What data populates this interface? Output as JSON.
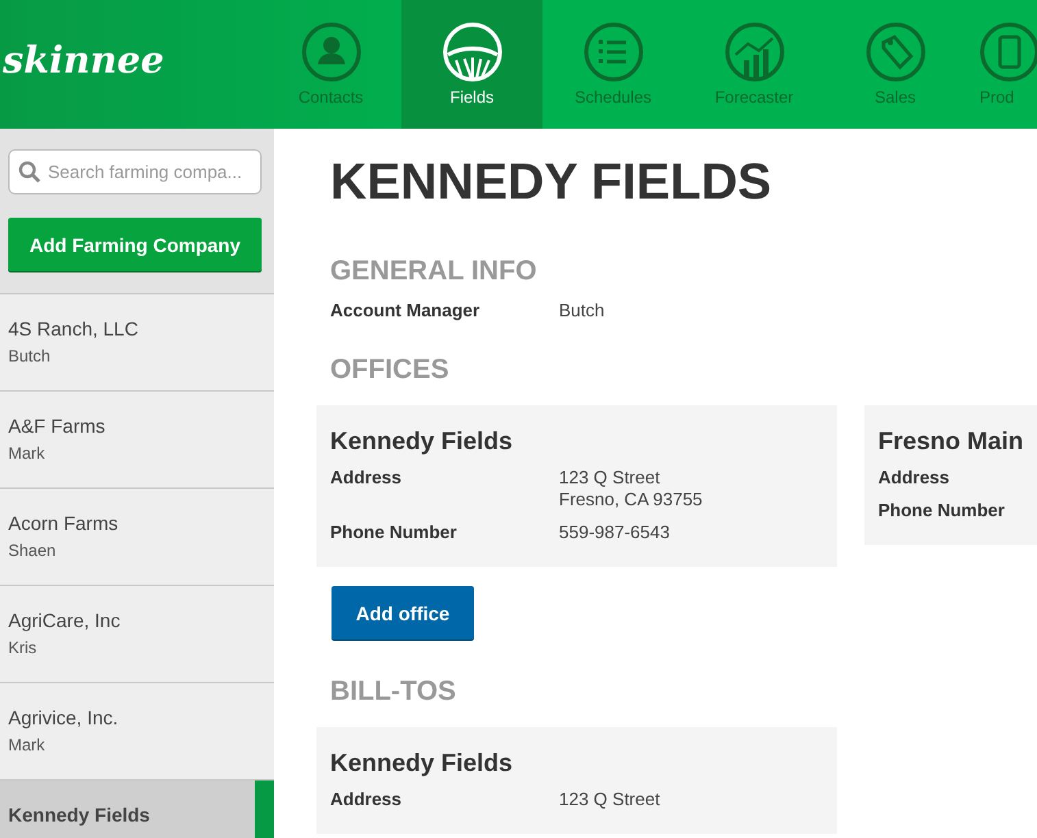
{
  "header": {
    "logo": "skinnee",
    "tabs": [
      {
        "label": "Contacts",
        "selected": false
      },
      {
        "label": "Fields",
        "selected": true
      },
      {
        "label": "Schedules",
        "selected": false
      },
      {
        "label": "Forecaster",
        "selected": false
      },
      {
        "label": "Sales",
        "selected": false
      },
      {
        "label": "Prod",
        "selected": false
      }
    ]
  },
  "sidebar": {
    "search": {
      "placeholder": "Search farming compa..."
    },
    "add_button": "Add Farming Company",
    "companies": [
      {
        "name": "4S Ranch, LLC",
        "manager": "Butch",
        "selected": false
      },
      {
        "name": "A&F Farms",
        "manager": "Mark",
        "selected": false
      },
      {
        "name": "Acorn Farms",
        "manager": "Shaen",
        "selected": false
      },
      {
        "name": "AgriCare, Inc",
        "manager": "Kris",
        "selected": false
      },
      {
        "name": "Agrivice, Inc.",
        "manager": "Mark",
        "selected": false
      },
      {
        "name": "Kennedy Fields",
        "selected": true
      }
    ]
  },
  "main": {
    "title": "KENNEDY FIELDS",
    "general_info": {
      "heading": "GENERAL INFO",
      "rows": [
        {
          "label": "Account Manager",
          "value": [
            "Butch"
          ]
        }
      ]
    },
    "offices": {
      "heading": "OFFICES",
      "cards": [
        {
          "name": "Kennedy Fields",
          "rows": [
            {
              "label": "Address",
              "value": [
                "123 Q Street",
                "Fresno, CA 93755"
              ]
            },
            {
              "label": "Phone Number",
              "value": [
                "559-987-6543"
              ]
            }
          ]
        },
        {
          "name": "Fresno Main",
          "rows": [
            {
              "label": "Address"
            },
            {
              "label": "Phone Number"
            }
          ]
        }
      ],
      "add_button": "Add office"
    },
    "bill_tos": {
      "heading": "BILL-TOS",
      "cards": [
        {
          "name": "Kennedy Fields",
          "rows": [
            {
              "label": "Address",
              "value": [
                "123 Q Street"
              ]
            }
          ]
        }
      ]
    }
  }
}
